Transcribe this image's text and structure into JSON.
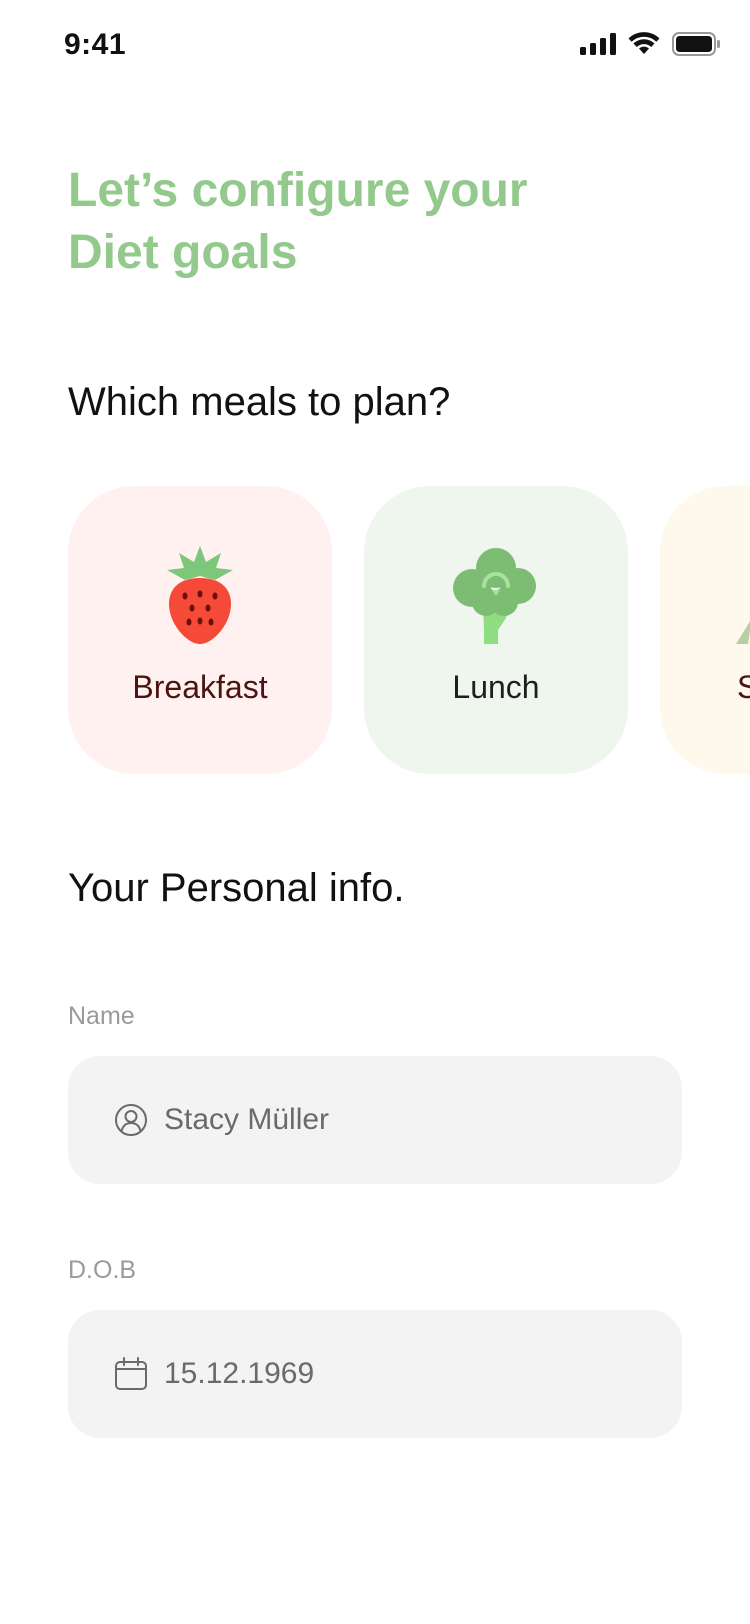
{
  "status_bar": {
    "time": "9:41",
    "icons": [
      "cellular-signal-icon",
      "wifi-icon",
      "battery-icon"
    ]
  },
  "header": {
    "title_line1": "Let’s configure your",
    "title_line2": "Diet goals",
    "title_color": "#93c98c"
  },
  "meals": {
    "title": "Which meals to plan?",
    "items": [
      {
        "label": "Breakfast",
        "icon": "strawberry-icon",
        "bg_color": "#fff1f0",
        "text_color": "#4a1410"
      },
      {
        "label": "Lunch",
        "icon": "broccoli-icon",
        "bg_color": "#eff6ee",
        "text_color": "#1f1f1f"
      },
      {
        "label": "S",
        "icon": "partial-meal-icon",
        "bg_color": "#fff8ec",
        "text_color": "#4a1410"
      }
    ]
  },
  "personal_info": {
    "title": "Your Personal info.",
    "name": {
      "label": "Name",
      "value": "Stacy Müller",
      "icon": "user-icon"
    },
    "dob": {
      "label": "D.O.B",
      "value": "15.12.1969",
      "icon": "calendar-icon"
    }
  }
}
